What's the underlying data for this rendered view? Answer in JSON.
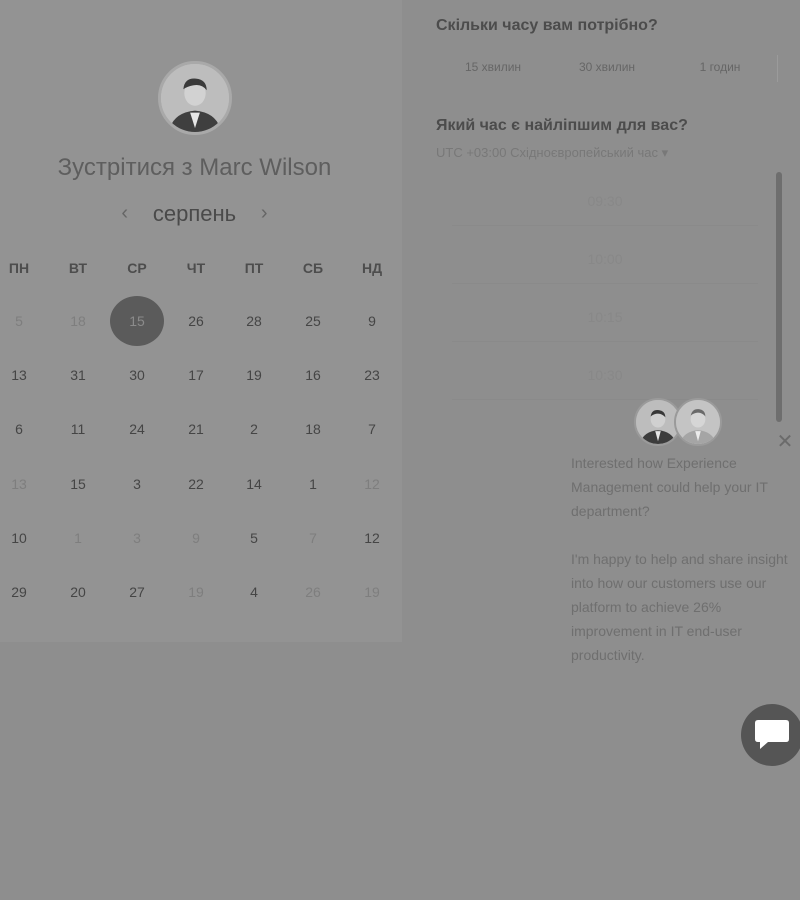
{
  "host": {
    "meet_title": "Зустрітися з Marc Wilson",
    "month": "серпень",
    "prev_month": "‹",
    "next_month": "›"
  },
  "calendar": {
    "weekdays": [
      "ПН",
      "ВТ",
      "СР",
      "ЧТ",
      "ПТ",
      "СБ",
      "НД"
    ],
    "weeks": [
      [
        "5",
        "18",
        "15",
        "26",
        "28",
        "25",
        "9"
      ],
      [
        "13",
        "31",
        "30",
        "17",
        "19",
        "16",
        "23"
      ],
      [
        "6",
        "11",
        "24",
        "21",
        "2",
        "18",
        "7"
      ],
      [
        "13",
        "15",
        "3",
        "22",
        "14",
        "1",
        "12"
      ],
      [
        "10",
        "1",
        "3",
        "9",
        "5",
        "7",
        "12"
      ],
      [
        "29",
        "20",
        "27",
        "19",
        "4",
        "26",
        "19"
      ]
    ],
    "selected": "15"
  },
  "duration": {
    "question": "Скільки часу вам потрібно?",
    "options": [
      "15 хвилин",
      "30 хвилин",
      "1 годин"
    ]
  },
  "time": {
    "question": "Який час є найліпшим для вас?",
    "timezone": "UTC +03:00 Східноєвропейський час ▾",
    "slots": [
      "09:30",
      "10:00",
      "10:15",
      "10:30"
    ]
  },
  "chat": {
    "close": "✕",
    "message_1": "Interested how Experience Management could help your IT department?",
    "message_2": "I'm happy to help and share insight into how our customers use our platform to achieve 26% improvement in IT end-user productivity."
  },
  "colors": {
    "overlay": "#8e8e8e",
    "selected_day": "#5b5b5b",
    "launcher": "#555555"
  }
}
